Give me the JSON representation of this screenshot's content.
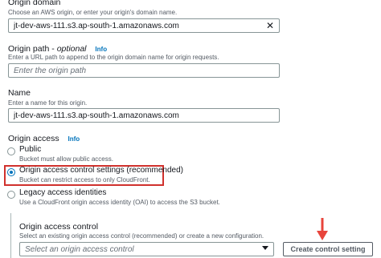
{
  "origin_domain": {
    "label": "Origin domain",
    "description": "Choose an AWS origin, or enter your origin's domain name.",
    "value": "jt-dev-aws-111.s3.ap-south-1.amazonaws.com"
  },
  "origin_path": {
    "label": "Origin path",
    "optional": "optional",
    "info": "Info",
    "description": "Enter a URL path to append to the origin domain name for origin requests.",
    "placeholder": "Enter the origin path"
  },
  "name": {
    "label": "Name",
    "description": "Enter a name for this origin.",
    "value": "jt-dev-aws-111.s3.ap-south-1.amazonaws.com"
  },
  "origin_access": {
    "label": "Origin access",
    "info": "Info",
    "options": [
      {
        "label": "Public",
        "description": "Bucket must allow public access.",
        "selected": false
      },
      {
        "label": "Origin access control settings (recommended)",
        "description": "Bucket can restrict access to only CloudFront.",
        "selected": true
      },
      {
        "label": "Legacy access identities",
        "description": "Use a CloudFront origin access identity (OAI) to access the S3 bucket.",
        "selected": false
      }
    ]
  },
  "oac": {
    "label": "Origin access control",
    "description": "Select an existing origin access control (recommended) or create a new configuration.",
    "placeholder": "Select an origin access control",
    "create_button": "Create control setting"
  },
  "colors": {
    "highlight": "#d0312d",
    "arrow": "#e8453c",
    "link": "#0073bb"
  }
}
